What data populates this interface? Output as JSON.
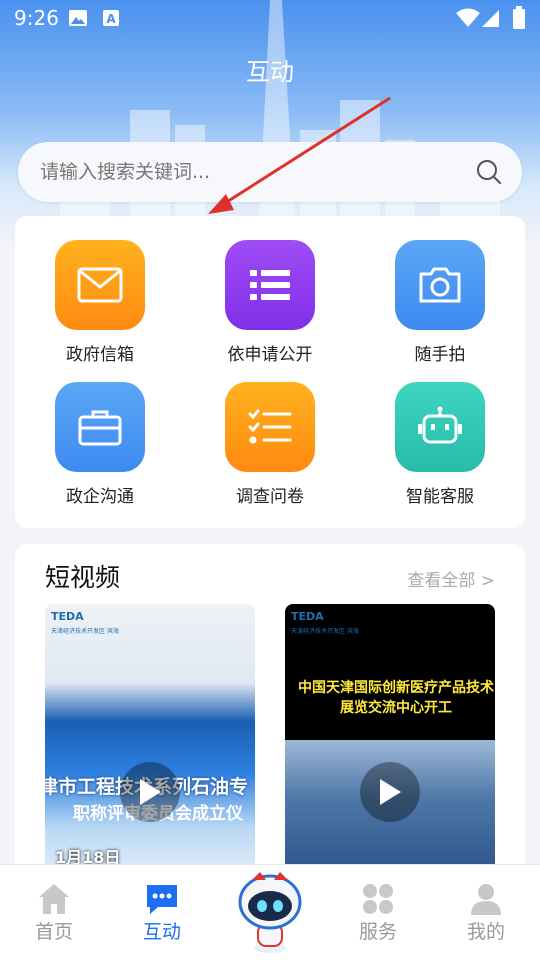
{
  "status_bar": {
    "time": "9:26"
  },
  "header": {
    "title": "互动"
  },
  "search": {
    "placeholder": "请输入搜索关键词..."
  },
  "services": [
    {
      "label": "政府信箱",
      "icon": "mail-icon",
      "color": "#ff9d12"
    },
    {
      "label": "依申请公开",
      "icon": "list-icon",
      "color": "#8f3cf0"
    },
    {
      "label": "随手拍",
      "icon": "camera-icon",
      "color": "#4c9af5"
    },
    {
      "label": "政企沟通",
      "icon": "briefcase-icon",
      "color": "#4c9af5"
    },
    {
      "label": "调查问卷",
      "icon": "checklist-icon",
      "color": "#ff9d12"
    },
    {
      "label": "智能客服",
      "icon": "robot-icon",
      "color": "#2fc9b3"
    }
  ],
  "videos": {
    "title": "短视频",
    "more": "查看全部 >",
    "items": [
      {
        "logo": "TEDA",
        "logo_sub": "天津经济技术开发区·滨海",
        "headline": "津市工程技术系列石油专",
        "subline": "职称评审委员会成立仪",
        "date": "1月18日"
      },
      {
        "logo": "TEDA",
        "logo_sub": "天津经济技术开发区·滨海",
        "headline": "中国天津国际创新医疗产品技术",
        "subline": "展览交流中心开工"
      }
    ]
  },
  "nav": {
    "items": [
      {
        "label": "首页",
        "icon": "home-icon",
        "active": false
      },
      {
        "label": "互动",
        "icon": "chat-icon",
        "active": true
      },
      {
        "label": "",
        "icon": "robot-mascot-icon",
        "active": false
      },
      {
        "label": "服务",
        "icon": "apps-icon",
        "active": false
      },
      {
        "label": "我的",
        "icon": "profile-icon",
        "active": false
      }
    ]
  },
  "colors": {
    "accent": "#1b6ff0",
    "annotation_arrow": "#e0302d"
  }
}
